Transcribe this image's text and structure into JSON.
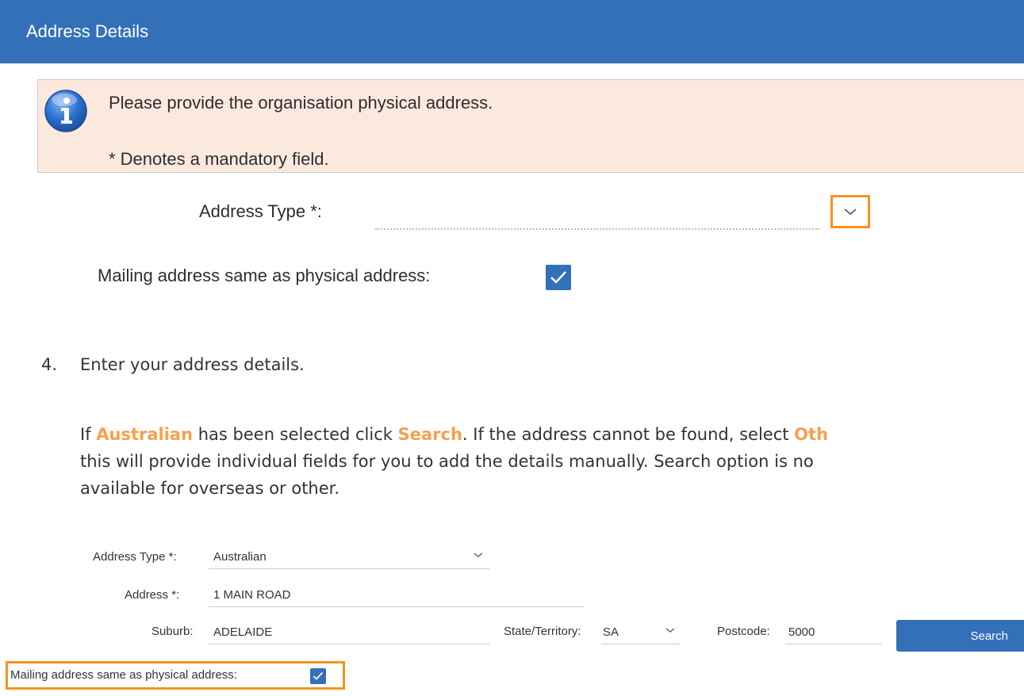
{
  "header": {
    "title": "Address Details",
    "bg_color": "#3370b8"
  },
  "info": {
    "icon": "info-icon",
    "line1": "Please provide the organisation physical address.",
    "line2": "* Denotes a mandatory field.",
    "bg_color": "#fbe9de"
  },
  "top_form": {
    "address_type_label": "Address Type *:",
    "address_type_value": "",
    "dropdown_icon": "chevron-down-icon",
    "mailing_label": "Mailing address same as physical address:",
    "mailing_checked": true,
    "highlight_color": "#f7931e"
  },
  "instructions": {
    "step_number": "4.",
    "step_text": "Enter your address details.",
    "para_1": "If ",
    "para_hl_1": "Australian",
    "para_2": " has been selected click ",
    "para_hl_2": "Search",
    "para_3": ". If the address cannot be found, select ",
    "para_hl_3": "Oth",
    "para_line2": "this will provide individual fields for you to add the details manually. Search option is no",
    "para_line3": "available for overseas or other.",
    "highlight_color": "#f7a04b"
  },
  "bottom_form": {
    "address_type_label": "Address Type *:",
    "address_type_value": "Australian",
    "address_label": "Address *:",
    "address_value": "1 MAIN ROAD",
    "suburb_label": "Suburb:",
    "suburb_value": "ADELAIDE",
    "state_label": "State/Territory:",
    "state_value": "SA",
    "postcode_label": "Postcode:",
    "postcode_value": "5000",
    "search_button": "Search",
    "mailing_label": "Mailing address same as physical address:",
    "mailing_checked": true
  }
}
